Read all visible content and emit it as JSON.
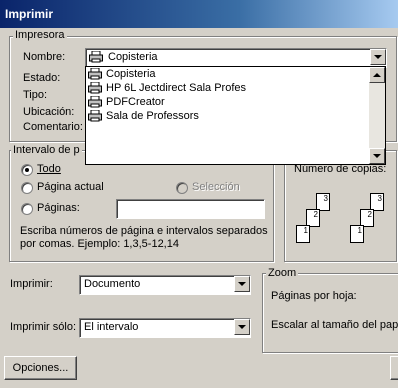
{
  "window": {
    "title": "Imprimir"
  },
  "printer_group": {
    "legend": "Impresora",
    "name_label": "Nombre:",
    "name_value": "Copisteria",
    "status_label": "Estado:",
    "type_label": "Tipo:",
    "location_label": "Ubicación:",
    "comment_label": "Comentario:"
  },
  "printer_dropdown": {
    "items": [
      {
        "label": "Copisteria",
        "icon": "printer-icon"
      },
      {
        "label": "HP 6L Jectdirect Sala Profes",
        "icon": "printer-icon"
      },
      {
        "label": "PDFCreator",
        "icon": "printer-icon"
      },
      {
        "label": "Sala de Professors",
        "icon": "printer-icon"
      }
    ]
  },
  "range_group": {
    "legend": "Intervalo de p",
    "all_label": "Todo",
    "current_label": "Página actual",
    "selection_label": "Selección",
    "pages_label": "Páginas:",
    "pages_value": "",
    "help_text_line1": "Escriba números de página e intervalos separados",
    "help_text_line2": "por comas. Ejemplo: 1,3,5-12,14",
    "selected": "Todo"
  },
  "copies_group": {
    "copies_label": "Número de copias:",
    "collate_icon_pages": [
      "1",
      "2",
      "3"
    ]
  },
  "print_what": {
    "label": "Imprimir:",
    "value": "Documento"
  },
  "print_only": {
    "label": "Imprimir sólo:",
    "value": "El intervalo"
  },
  "zoom_group": {
    "legend": "Zoom",
    "pages_per_sheet_label": "Páginas por hoja:",
    "scale_label": "Escalar al tamaño del pape"
  },
  "options_button": {
    "label": "Opciones..."
  },
  "colors": {
    "titlebar_start": "#0a246a",
    "titlebar_end": "#a6caf0",
    "face": "#d4d0c8"
  }
}
